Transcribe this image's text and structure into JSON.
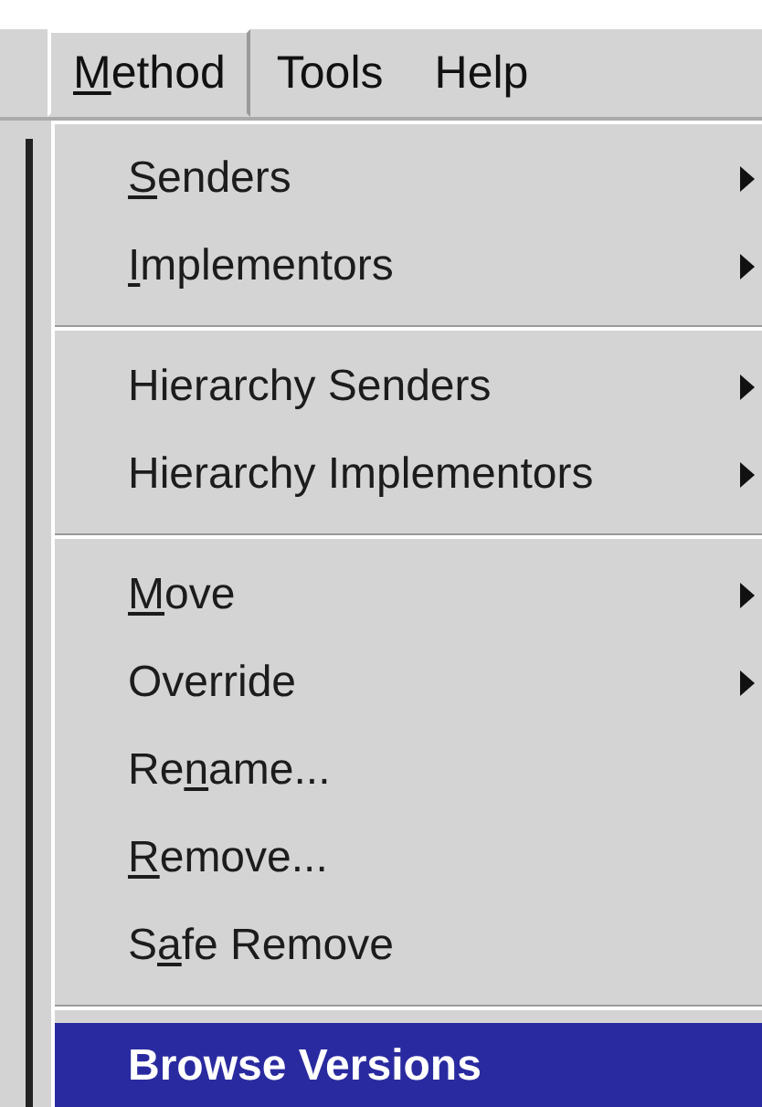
{
  "menubar": [
    {
      "label": {
        "key": "M",
        "after": "ethod"
      },
      "selected": true
    },
    {
      "label": {
        "before": "Tools"
      },
      "selected": false
    },
    {
      "label": {
        "before": "Help"
      },
      "selected": false
    }
  ],
  "menu": [
    {
      "kind": "item",
      "label": {
        "key": "S",
        "after": "enders"
      },
      "submenu": true,
      "selected": false
    },
    {
      "kind": "item",
      "label": {
        "key": "I",
        "after": "mplementors"
      },
      "submenu": true,
      "selected": false
    },
    {
      "kind": "separator"
    },
    {
      "kind": "item",
      "label": {
        "before": "Hierarchy Senders"
      },
      "submenu": true,
      "selected": false
    },
    {
      "kind": "item",
      "label": {
        "before": "Hierarchy Implementors"
      },
      "submenu": true,
      "selected": false
    },
    {
      "kind": "separator"
    },
    {
      "kind": "item",
      "label": {
        "key": "M",
        "after": "ove"
      },
      "submenu": true,
      "selected": false
    },
    {
      "kind": "item",
      "label": {
        "before": "Override"
      },
      "submenu": true,
      "selected": false
    },
    {
      "kind": "item",
      "label": {
        "before": "Re",
        "key": "n",
        "after": "ame..."
      },
      "submenu": false,
      "selected": false
    },
    {
      "kind": "item",
      "label": {
        "key": "R",
        "after": "emove..."
      },
      "submenu": false,
      "selected": false
    },
    {
      "kind": "item",
      "label": {
        "before": "S",
        "key": "a",
        "after": "fe Remove"
      },
      "submenu": false,
      "selected": false
    },
    {
      "kind": "separator"
    },
    {
      "kind": "item",
      "label": {
        "before": "Browse Versions"
      },
      "submenu": false,
      "selected": true
    }
  ]
}
